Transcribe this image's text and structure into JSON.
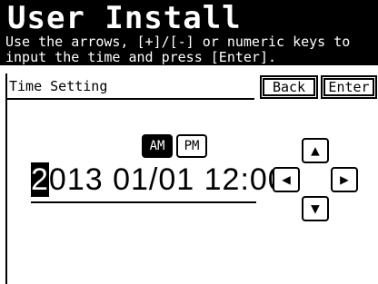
{
  "header": {
    "title": "User Install",
    "instruction_line1": "Use the arrows, [+]/[-] or numeric keys to",
    "instruction_line2": "input the time and press [Enter]."
  },
  "section": {
    "label": "Time Setting"
  },
  "buttons": {
    "back": "Back",
    "enter": "Enter"
  },
  "ampm": {
    "am": "AM",
    "pm": "PM",
    "selected": "AM"
  },
  "time": {
    "cursor_char": "2",
    "rest": "013 01/01 12:00"
  },
  "arrows": {
    "up": "▲",
    "down": "▼",
    "left": "◀",
    "right": "▶"
  }
}
